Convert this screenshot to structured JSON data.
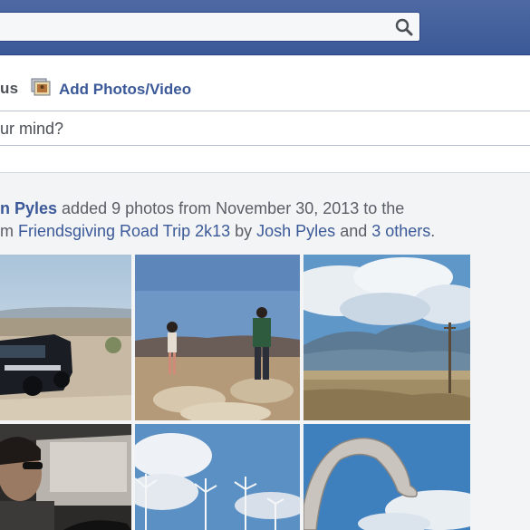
{
  "composer": {
    "status_tab_label": "us",
    "add_photos_label": "Add Photos/Video",
    "input_placeholder": "ur mind?"
  },
  "story": {
    "actor": "n Pyles",
    "action": " added 9 photos from November 30, 2013 to the",
    "line2_prefix": "m ",
    "album": "Friendsgiving Road Trip 2k13",
    "by": " by ",
    "owner": "Josh Pyles",
    "and": " and ",
    "others": "3 others",
    "end": "."
  },
  "photos": [
    {
      "name": "photo-suv-desert"
    },
    {
      "name": "photo-two-people-desert"
    },
    {
      "name": "photo-mountains-clouds"
    },
    {
      "name": "photo-man-in-car"
    },
    {
      "name": "photo-wind-turbines"
    },
    {
      "name": "photo-dinosaur-statue"
    }
  ],
  "icons": {
    "search": "search-icon",
    "photos": "photo-album-icon"
  },
  "colors": {
    "brand_blue": "#3b5998",
    "link_blue": "#3b5998",
    "background": "#e9ebee"
  }
}
